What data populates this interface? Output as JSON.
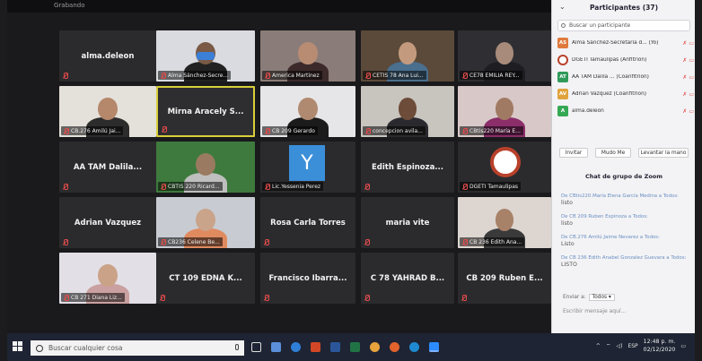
{
  "meeting": {
    "top_label": "Grabando"
  },
  "tiles": [
    {
      "name": "alma.deleon",
      "label": "",
      "mode": "name"
    },
    {
      "name": "",
      "label": "Alma Sánchez-Secre...",
      "mode": "video",
      "skin": "#7a5a45",
      "bg": "#d9dbe0",
      "shirt": "#222",
      "mask": true
    },
    {
      "name": "",
      "label": "America Martinez",
      "mode": "video",
      "skin": "#b88c73",
      "bg": "#8a7c78",
      "shirt": "#3c2a2a"
    },
    {
      "name": "",
      "label": "CETIS 78 Ana Lui...",
      "mode": "video",
      "skin": "#c49a7e",
      "bg": "#5b4a3a",
      "shirt": "#4a6f8f"
    },
    {
      "name": "",
      "label": "CE78 EMILIA REY...",
      "mode": "video",
      "skin": "#a88b7a",
      "bg": "#2f2f33",
      "shirt": "#1e1e22"
    },
    {
      "name": "",
      "label": "CB.276 Amilú Jai...",
      "mode": "video",
      "skin": "#b5876b",
      "bg": "#e4e0da",
      "shirt": "#2c2c2c"
    },
    {
      "name": "Mirna Aracely S...",
      "label": "",
      "mode": "name",
      "active": true
    },
    {
      "name": "",
      "label": "CB 209 Gerardo",
      "mode": "video",
      "skin": "#b08a70",
      "bg": "#e6e6e8",
      "shirt": "#1b1b1b"
    },
    {
      "name": "",
      "label": "concepcion avila...",
      "mode": "video",
      "skin": "#6d4c3a",
      "bg": "#c8c4be",
      "shirt": "#2a2a2e"
    },
    {
      "name": "",
      "label": "CBtis220 María E...",
      "mode": "video",
      "skin": "#a07a63",
      "bg": "#d8c9c8",
      "shirt": "#8c2e6a"
    },
    {
      "name": "AA TAM Dalila...",
      "label": "",
      "mode": "name"
    },
    {
      "name": "",
      "label": "CBTIS 220 Ricard...",
      "mode": "video",
      "skin": "#9a7a60",
      "bg": "#3e7a3e",
      "shirt": "#bfbfbf"
    },
    {
      "name": "",
      "label": "Lic.Yessenia Perez",
      "mode": "letter",
      "letter": "Y"
    },
    {
      "name": "Edith  Espinoza...",
      "label": "",
      "mode": "name"
    },
    {
      "name": "",
      "label": "DGETI Tamaulipas",
      "mode": "logo"
    },
    {
      "name": "Adrian Vazquez",
      "label": "",
      "mode": "name"
    },
    {
      "name": "",
      "label": "CB236 Celene Be...",
      "mode": "video",
      "skin": "#c9a38a",
      "bg": "#c8ccd2",
      "shirt": "#e08a60"
    },
    {
      "name": "Rosa Carla Torres",
      "label": "",
      "mode": "name"
    },
    {
      "name": "maria vite",
      "label": "",
      "mode": "name"
    },
    {
      "name": "",
      "label": "CB 236 Edith Ana...",
      "mode": "video",
      "skin": "#a78168",
      "bg": "#ddd6d0",
      "shirt": "#3a3a3a"
    },
    {
      "name": "",
      "label": "CB 271 Diana Liz...",
      "mode": "video",
      "skin": "#caa287",
      "bg": "#e3dfe6",
      "shirt": "#caa0a0"
    },
    {
      "name": "CT 109 EDNA K...",
      "label": "",
      "mode": "name"
    },
    {
      "name": "Francisco  Ibarra...",
      "label": "",
      "mode": "name"
    },
    {
      "name": "C 78 YAHRAD B...",
      "label": "",
      "mode": "name"
    },
    {
      "name": "CB 209 Ruben E...",
      "label": "",
      "mode": "name"
    }
  ],
  "panel": {
    "title": "Participantes (37)",
    "search_placeholder": "Buscar un participante",
    "participants": [
      {
        "initials": "AS",
        "name": "Alma Sánchez-Secretaría d... (Yo)",
        "color": "#e07a3c"
      },
      {
        "initials": "",
        "name": "DGETI Tamaulipas (Anfitrión)",
        "color": "#b8412b"
      },
      {
        "initials": "AT",
        "name": "AA TAM Dalila ... (Coanfitrión)",
        "color": "#2f9a5a"
      },
      {
        "initials": "AV",
        "name": "Adrian Vazquez (Coanfitrión)",
        "color": "#e0a33c"
      },
      {
        "initials": "A",
        "name": "alma.deleon",
        "color": "#35a853"
      }
    ],
    "buttons": {
      "invite": "Invitar",
      "mute_all": "Mudo Me",
      "raise_hand": "Levantar la mano"
    },
    "chat_title": "Chat de grupo de Zoom",
    "messages": [
      {
        "from": "De CBtis220.María Elena García Medina a Todos:",
        "text": "listo"
      },
      {
        "from": "De CB 209 Ruben Espinoza a Todos:",
        "text": "listo"
      },
      {
        "from": "De CB.276 Amilú Jaime Nevarez a Todos:",
        "text": "Listo"
      },
      {
        "from": "De CB 236 Edith Anabel Gonzalez Guevara a Todos:",
        "text": "LISTO"
      }
    ],
    "send_to_label": "Enviar a:",
    "send_to_value": "Todos ▾",
    "chat_placeholder": "Escribir mensaje aquí..."
  },
  "taskbar": {
    "search_placeholder": "Buscar cualquier cosa",
    "lang": "ESP",
    "time": "12:48 p. m.",
    "date": "02/12/2020"
  },
  "colors": {
    "active_border": "#d8cf3a",
    "muted": "#e34b4b",
    "taskbar": "#1e2433"
  }
}
